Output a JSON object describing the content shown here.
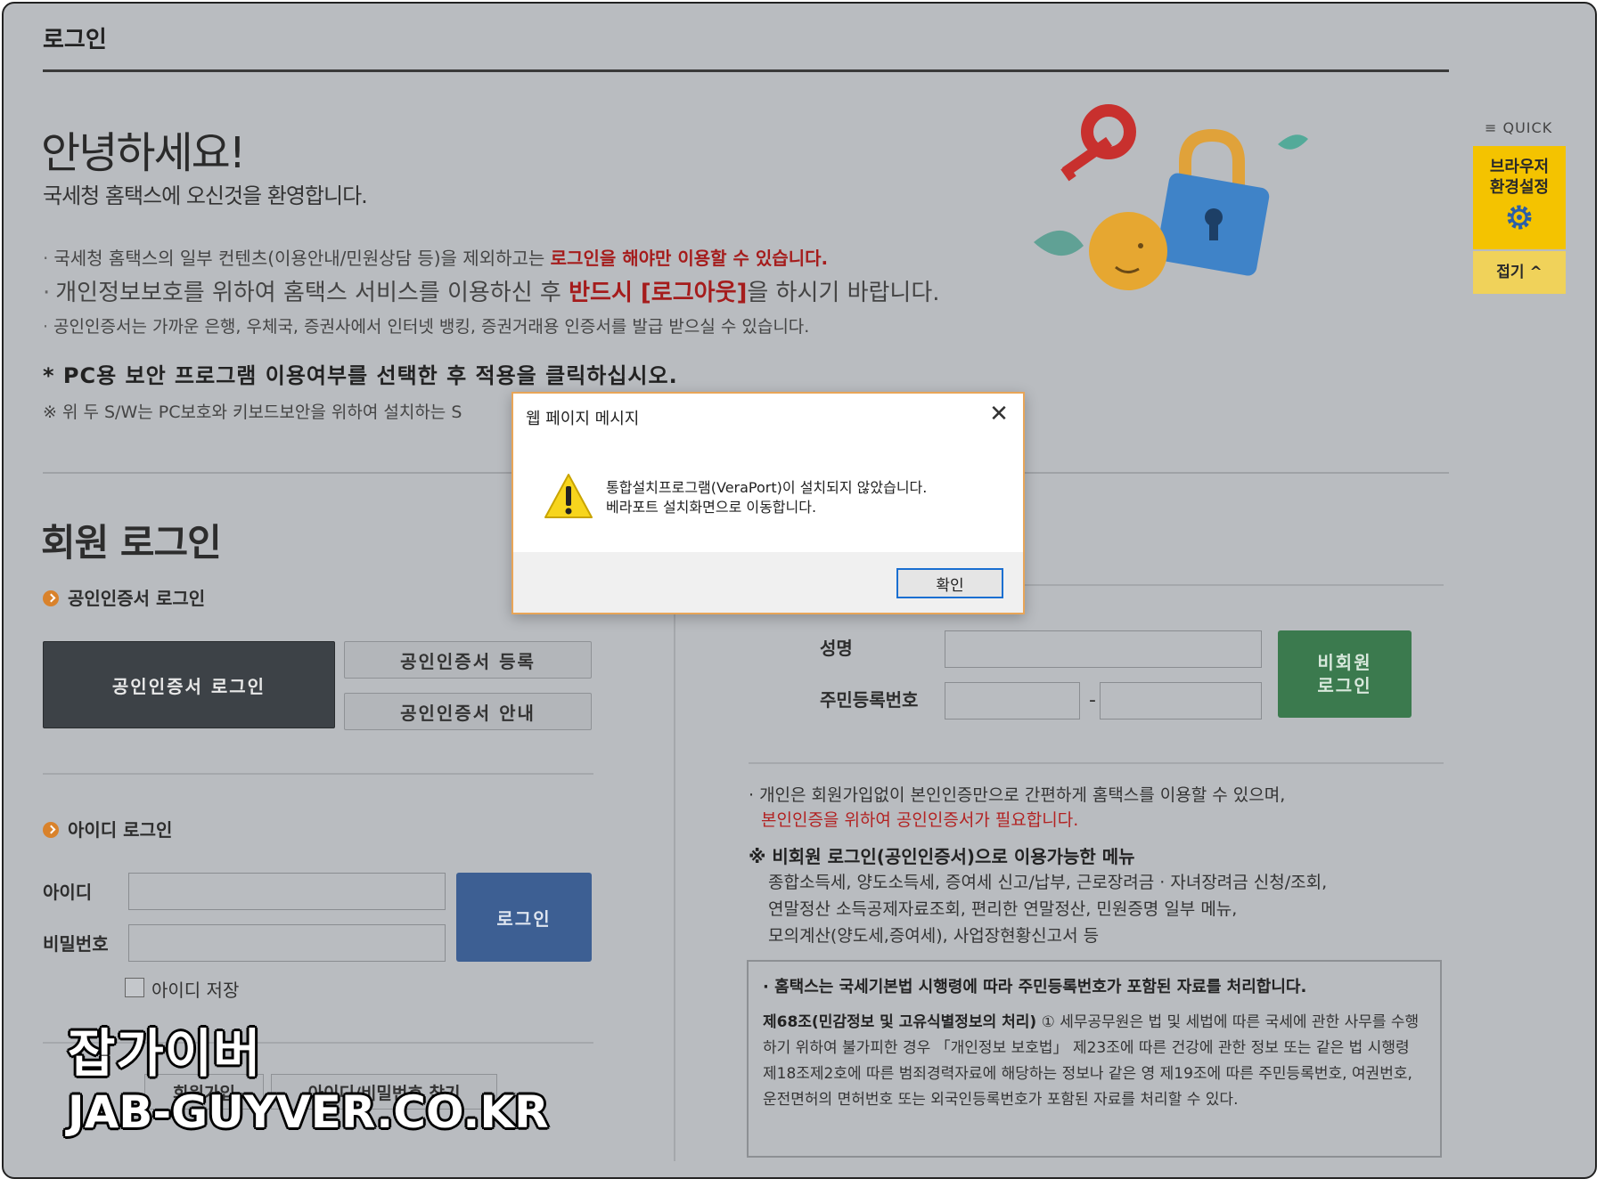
{
  "header": {
    "title": "로그인"
  },
  "greeting": {
    "hello": "안녕하세요!",
    "welcome": "국세청 홈택스에 오신것을 환영합니다."
  },
  "notices": {
    "n1_text": "국세청 홈택스의 일부 컨텐츠(이용안내/민원상담 등)을 제외하고는 ",
    "n1_emph": "로그인을 해야만 이용할 수 있습니다.",
    "n2_text": "개인정보보호를 위하여 홈택스 서비스를 이용하신 후 ",
    "n2_emph": "반드시 [로그아웃]",
    "n2_tail": "을 하시기 바랍니다.",
    "n3_text": "공인인증서는 가까운 은행, 우체국, 증권사에서 인터넷 뱅킹, 증권거래용 인증서를 발급 받으실 수 있습니다.",
    "bullet": "·"
  },
  "pc_security": {
    "title": "* PC용 보안 프로그램 이용여부를 선택한 후 적용을 클릭하십시오.",
    "note": "※ 위 두 S/W는 PC보호와 키보드보안을 위하여 설치하는 S"
  },
  "quick": {
    "head": "≡ QUICK",
    "browser_label": "브라우저\n환경설정",
    "fold_label": "접기 ^",
    "icon": "gear-icon",
    "accent": "#f4c300"
  },
  "member": {
    "title": "회원 로그인",
    "cert_heading": "공인인증서 로그인",
    "cert_login": "공인인증서 로그인",
    "cert_register": "공인인증서 등록",
    "cert_guide": "공인인증서 안내",
    "id_heading": "아이디 로그인",
    "id_label": "아이디",
    "pw_label": "비밀번호",
    "login_button": "로그인",
    "save_id": "아이디 저장",
    "join": "회원가입",
    "find": "아이디/비밀번호 찾기"
  },
  "guest": {
    "name_label": "성명",
    "rrn_label": "주민등록번호",
    "dash": "-",
    "button": "비회원\n로그인",
    "line1": "· 개인은 회원가입없이 본인인증만으로 간편하게 홈택스를 이용할 수 있으며,",
    "line2": "본인인증을 위하여 공인인증서가 필요합니다.",
    "menu_title": "※ 비회원 로그인(공인인증서)으로 이용가능한 메뉴",
    "menu_lines": [
      "종합소득세, 양도소득세, 증여세 신고/납부, 근로장려금 · 자녀장려금 신청/조회,",
      "연말정산 소득공제자료조회, 편리한 연말정산, 민원증명 일부 메뉴,",
      "모의계산(양도세,증여세), 사업장현황신고서 등"
    ],
    "law_title": "· 홈택스는 국세기본법 시행령에 따라 주민등록번호가 포함된 자료를 처리합니다.",
    "law_article": "제68조(민감정보 및 고유식별정보의 처리)",
    "law_body": " ① 세무공무원은 법 및 세법에 따른 국세에 관한 사무를 수행하기 위하여 불가피한 경우 「개인정보 보호법」 제23조에 따른 건강에 관한 정보 또는 같은 법 시행령 제18조제2호에 따른 범죄경력자료에 해당하는 정보나 같은 영 제19조에 따른 주민등록번호, 여권번호, 운전면허의 면허번호 또는 외국인등록번호가 포함된 자료를 처리할 수 있다."
  },
  "dialog": {
    "title": "웹 페이지 메시지",
    "close": "✕",
    "message1": "통합설치프로그램(VeraPort)이 설치되지 않았습니다.",
    "message2": "베라포트 설치화면으로 이동합니다.",
    "ok": "확인",
    "icon": "warning-icon"
  },
  "watermark": {
    "name": "잡가이버",
    "url": "JAB-GUYVER.CO.KR"
  },
  "colors": {
    "page_bg": "#b9bcc0",
    "emphasis_red": "#a51c1c",
    "login_blue": "#3d5f93",
    "guest_green": "#3b7a4e",
    "dark_button": "#3d4247",
    "dialog_border": "#e8a558"
  }
}
